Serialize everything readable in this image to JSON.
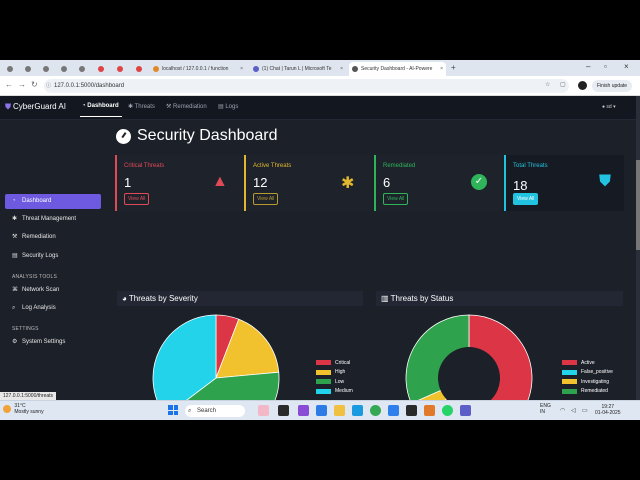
{
  "browser": {
    "tabs": [
      {
        "label": "localhost / 127.0.0.1 / function"
      },
      {
        "label": "(1) Chat | Tarun L | Microsoft Te"
      },
      {
        "label": "Security Dashboard - AI-Powere"
      }
    ],
    "url": "127.0.0.1:5000/dashboard",
    "finish_update": "Finish update",
    "status_url": "127.0.0.1:5000/threats"
  },
  "app": {
    "brand": "CyberGuard AI",
    "nav": [
      {
        "label": "Dashboard"
      },
      {
        "label": "Threats"
      },
      {
        "label": "Remediation"
      },
      {
        "label": "Logs"
      }
    ],
    "user": "sd"
  },
  "sidebar": {
    "items": [
      {
        "label": "Dashboard",
        "icon": "gauge-icon"
      },
      {
        "label": "Threat Management",
        "icon": "bug-icon"
      },
      {
        "label": "Remediation",
        "icon": "wrench-icon"
      },
      {
        "label": "Security Logs",
        "icon": "file-icon"
      }
    ],
    "tools_heading": "ANALYSIS TOOLS",
    "tools": [
      {
        "label": "Network Scan",
        "icon": "network-icon"
      },
      {
        "label": "Log Analysis",
        "icon": "search-icon"
      }
    ],
    "settings_heading": "SETTINGS",
    "settings": [
      {
        "label": "System Settings",
        "icon": "gear-icon"
      }
    ]
  },
  "main": {
    "title": "Security Dashboard",
    "cards": [
      {
        "label": "Critical Threats",
        "value": "1",
        "button": "View All",
        "color": "#e04a57",
        "icon": "warning-icon"
      },
      {
        "label": "Active Threats",
        "value": "12",
        "button": "View All",
        "color": "#e0b72e",
        "icon": "bug-icon"
      },
      {
        "label": "Remediated",
        "value": "6",
        "button": "View All",
        "color": "#2fb45a",
        "icon": "check-icon"
      },
      {
        "label": "Total Threats",
        "value": "18",
        "button": "View All",
        "color": "#22c3e0",
        "icon": "shield-icon"
      }
    ],
    "severity_title": "Threats by Severity",
    "status_title": "Threats by Status"
  },
  "chart_data": [
    {
      "type": "pie",
      "title": "Threats by Severity",
      "categories": [
        "Critical",
        "High",
        "Low",
        "Medium"
      ],
      "values": [
        1,
        3,
        7,
        6
      ],
      "colors": [
        "#dc3545",
        "#f2c12e",
        "#2ea24c",
        "#22d3ea"
      ],
      "legend": "right"
    },
    {
      "type": "pie",
      "title": "Threats by Status",
      "categories": [
        "Active",
        "False_positive",
        "Investigating",
        "Remediated"
      ],
      "values": [
        12,
        0,
        1,
        6
      ],
      "colors": [
        "#dc3545",
        "#22d3ea",
        "#f2c12e",
        "#2ea24c"
      ],
      "legend": "right",
      "donut": true
    }
  ],
  "taskbar": {
    "weather_temp": "31°C",
    "weather_desc": "Mostly sunny",
    "search": "Search",
    "lang": "ENG",
    "region": "IN",
    "time": "19:27",
    "date": "01-04-2025"
  }
}
